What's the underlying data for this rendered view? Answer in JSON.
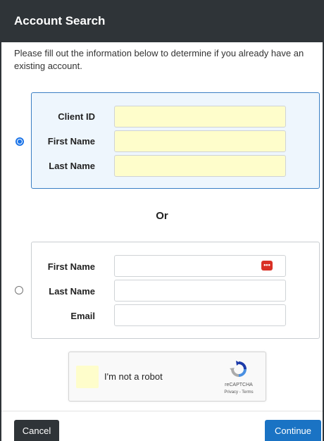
{
  "header": {
    "title": "Account Search"
  },
  "intro": "Please fill out the information below to determine if you already have an existing account.",
  "option1": {
    "selected": true,
    "fields": [
      {
        "label": "Client ID",
        "value": ""
      },
      {
        "label": "First Name",
        "value": ""
      },
      {
        "label": "Last Name",
        "value": ""
      }
    ]
  },
  "separator": "Or",
  "option2": {
    "selected": false,
    "fields": [
      {
        "label": "First Name",
        "value": ""
      },
      {
        "label": "Last Name",
        "value": ""
      },
      {
        "label": "Email",
        "value": ""
      }
    ],
    "password_manager_icon": "•••"
  },
  "recaptcha": {
    "label": "I'm not a robot",
    "brand": "reCAPTCHA",
    "terms": "Privacy - Terms"
  },
  "footer": {
    "cancel_label": "Cancel",
    "continue_label": "Continue"
  },
  "colors": {
    "header_bg": "#2f3438",
    "active_group_bg": "#eef6fd",
    "autofill_yellow": "#fefdcb",
    "primary_button": "#1a73c4"
  }
}
